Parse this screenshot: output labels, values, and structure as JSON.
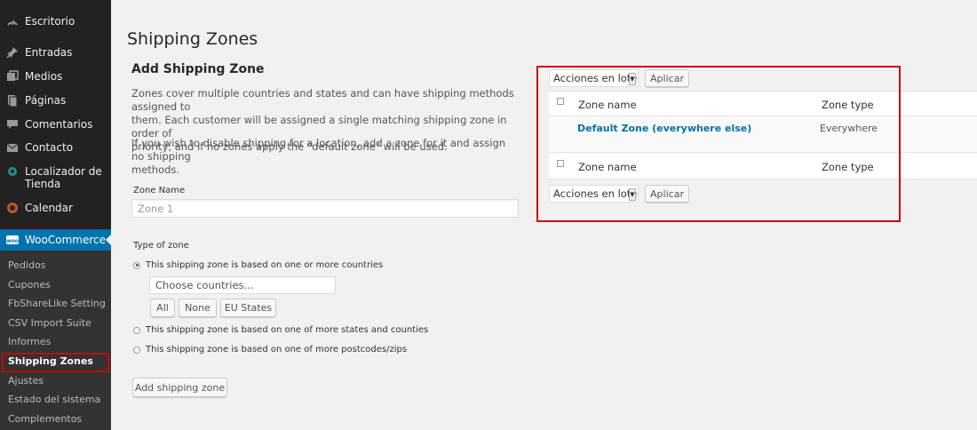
{
  "sidebar": {
    "menu": [
      {
        "label": "Escritorio",
        "icon": "dashboard-icon"
      },
      {
        "label": "Entradas",
        "icon": "pin-icon"
      },
      {
        "label": "Medios",
        "icon": "media-icon"
      },
      {
        "label": "Páginas",
        "icon": "pages-icon"
      },
      {
        "label": "Comentarios",
        "icon": "comment-icon"
      },
      {
        "label": "Contacto",
        "icon": "mail-icon"
      },
      {
        "label": "Localizador de",
        "label2": "Tienda",
        "icon": "location-icon"
      },
      {
        "label": "Calendar",
        "icon": "calendar-icon"
      },
      {
        "label": "WooCommerce",
        "icon": "woocommerce-icon"
      }
    ],
    "submenu": [
      "Pedidos",
      "Cupones",
      "FbShareLike Setting",
      "CSV Import Suite",
      "Informes",
      "Shipping Zones",
      "Ajustes",
      "Estado del sistema",
      "Complementos"
    ]
  },
  "page": {
    "title": "Shipping Zones"
  },
  "form": {
    "title": "Add Shipping Zone",
    "para1_line1": "Zones cover multiple countries and states and can have shipping methods assigned to",
    "para1_line2": "them. Each customer will be assigned a single matching shipping zone in order of",
    "para1_line3": "priority, and if no zones apply the \"default zone\" will be used.",
    "para2_line1": "If you wish to disable shipping for a location, add a zone for it and assign no shipping",
    "para2_line2": "methods.",
    "zone_name_label": "Zone Name",
    "zone_name_placeholder": "Zone 1",
    "type_label": "Type of zone",
    "radio_countries": "This shipping zone is based on one or more countries",
    "countries_placeholder": "Choose countries...",
    "btn_all": "All",
    "btn_none": "None",
    "btn_eu": "EU States",
    "radio_states": "This shipping zone is based on one of more states and counties",
    "radio_postcodes": "This shipping zone is based on one of more postcodes/zips",
    "submit": "Add shipping zone"
  },
  "table": {
    "bulk_label": "Acciones en lote",
    "apply_label": "Aplicar",
    "col_name": "Zone name",
    "col_type": "Zone type",
    "rows": [
      {
        "name": "Default Zone (everywhere else)",
        "type": "Everywhere"
      }
    ]
  },
  "colors": {
    "sidebar": "#222222",
    "submenu": "#333333",
    "accent": "#0073aa",
    "highlight": "#cc0000"
  }
}
